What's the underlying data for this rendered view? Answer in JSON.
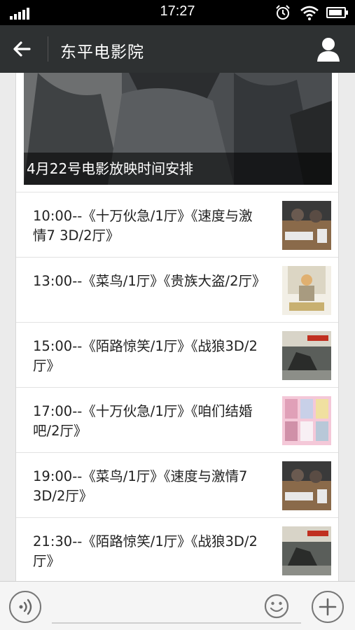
{
  "status_bar": {
    "time": "17:27",
    "icons": [
      "signal-icon",
      "alarm-icon",
      "wifi-icon",
      "battery-icon"
    ]
  },
  "nav": {
    "title": "东平电影院",
    "back_icon": "back-arrow-icon",
    "profile_icon": "profile-icon"
  },
  "banner": {
    "caption": "4月22号电影放映时间安排"
  },
  "schedule": [
    {
      "text": "10:00--《十万伙急/1厅》《速度与激情7 3D/2厅》",
      "thumb": "speed7-poster"
    },
    {
      "text": "13:00--《菜鸟/1厅》《贵族大盗/2厅》",
      "thumb": "aristocrat-thief-poster"
    },
    {
      "text": "15:00--《陌路惊笑/1厅》《战狼3D/2厅》",
      "thumb": "wolf-warrior-poster"
    },
    {
      "text": "17:00--《十万伙急/1厅》《咱们结婚吧/2厅》",
      "thumb": "lets-get-married-poster"
    },
    {
      "text": "19:00--《菜鸟/1厅》《速度与激情7 3D/2厅》",
      "thumb": "speed7-poster"
    },
    {
      "text": "21:30--《陌路惊笑/1厅》《战狼3D/2厅》",
      "thumb": "wolf-warrior-poster"
    }
  ],
  "input_bar": {
    "placeholder": "",
    "voice_icon": "voice-icon",
    "emoji_icon": "emoji-icon",
    "plus_icon": "plus-icon"
  },
  "colors": {
    "navbar": "#2e3132",
    "status_bar": "#000000",
    "background": "#ebebeb"
  }
}
